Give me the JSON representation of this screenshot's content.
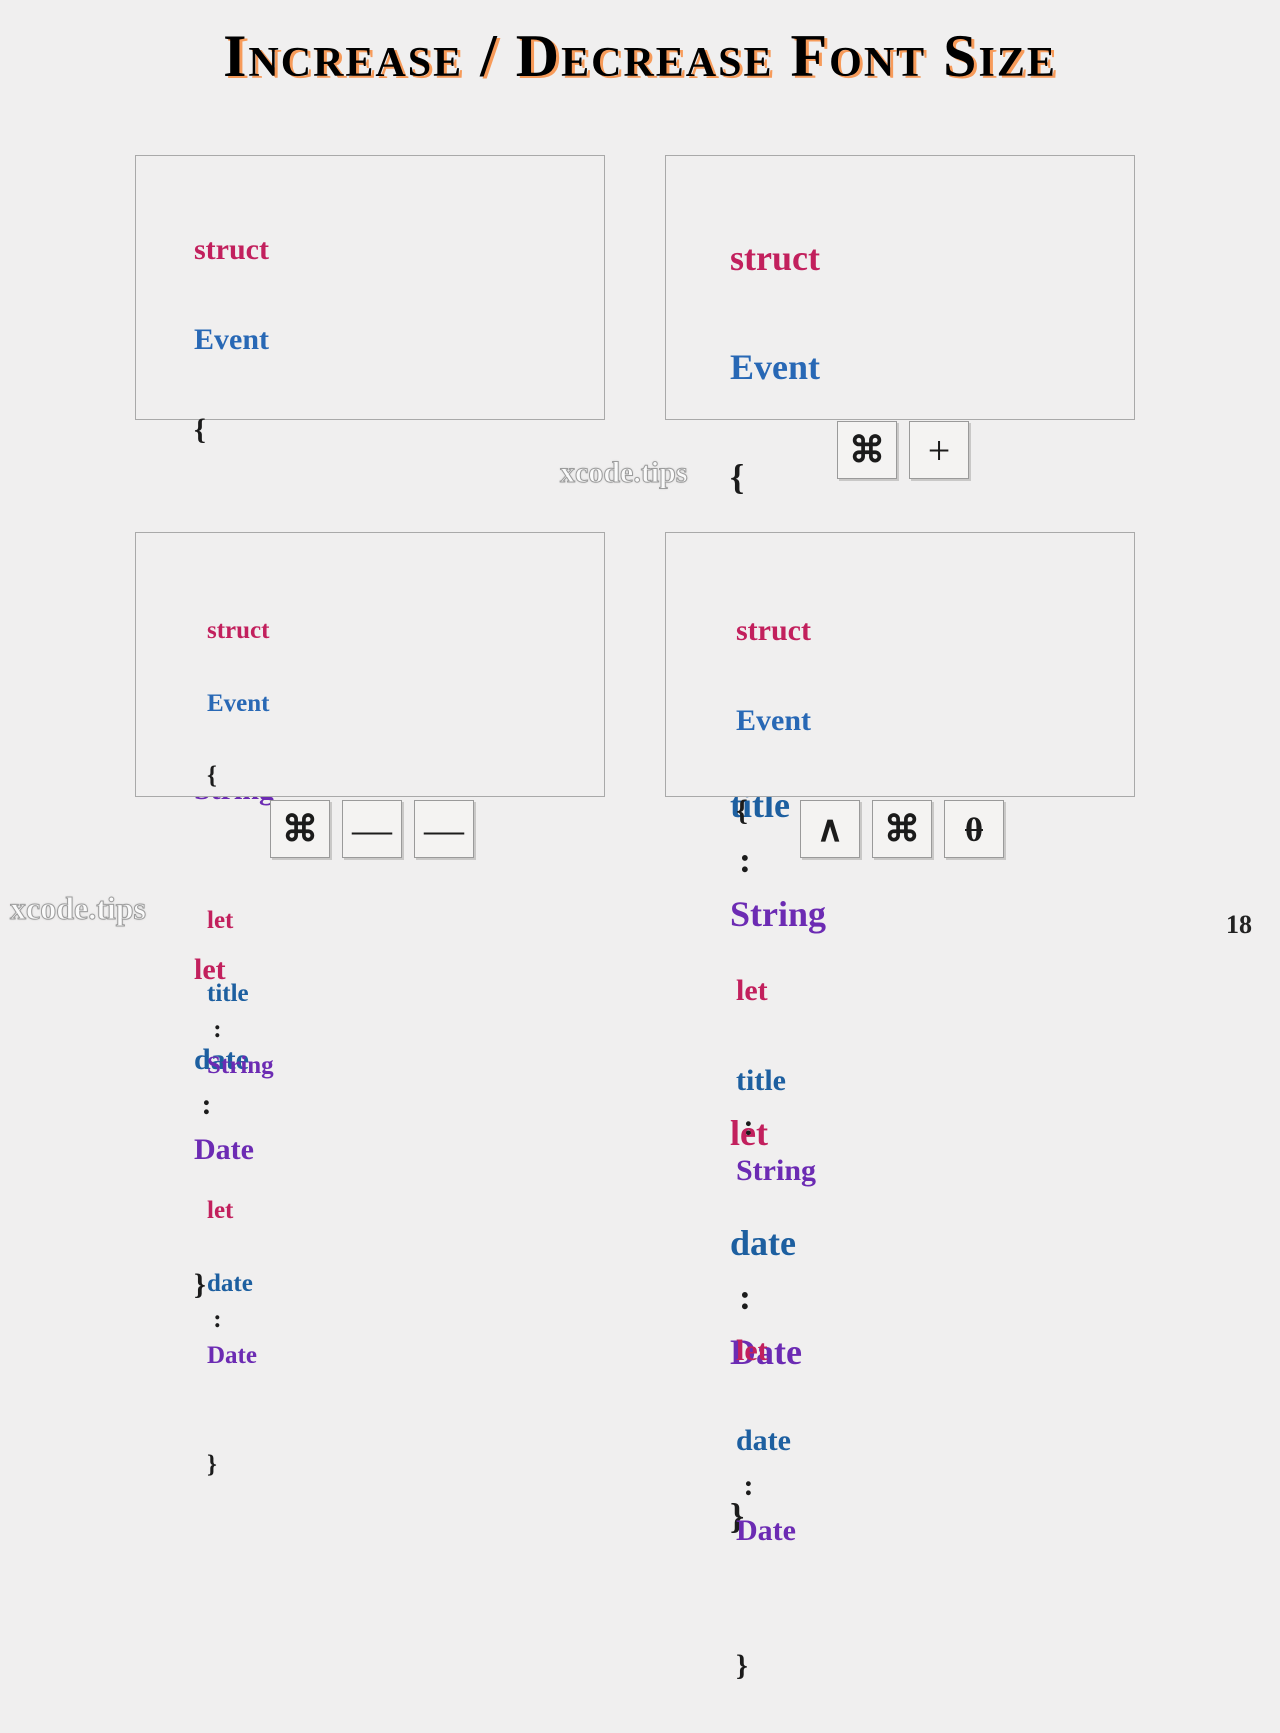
{
  "title": "Increase / Decrease Font Size",
  "watermark": "xcode.tips",
  "page_number": "18",
  "code": {
    "kw_struct": "struct",
    "type_name": "Event",
    "brace_open": "{",
    "brace_close": "}",
    "kw_let": "let",
    "prop_title": "title",
    "prop_date": "date",
    "colon": ":",
    "type_string": "String",
    "type_date": "Date"
  },
  "keys": {
    "command": "⌘",
    "control": "∧",
    "plus": "+",
    "minus": "—",
    "zero": "0"
  }
}
